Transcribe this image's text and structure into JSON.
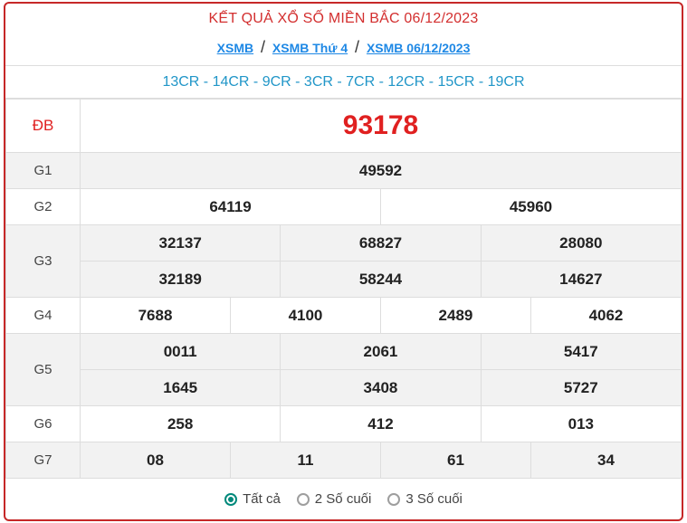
{
  "title": "KẾT QUẢ XỔ SỐ MIỀN BẮC 06/12/2023",
  "breadcrumb": {
    "sep": "/",
    "items": [
      "XSMB",
      "XSMB Thứ 4",
      "XSMB 06/12/2023"
    ]
  },
  "codes": "13CR - 14CR - 9CR - 3CR - 7CR - 12CR - 15CR - 19CR",
  "prizes": {
    "db": {
      "label": "ĐB",
      "numbers": [
        "93178"
      ]
    },
    "g1": {
      "label": "G1",
      "numbers": [
        "49592"
      ]
    },
    "g2": {
      "label": "G2",
      "numbers": [
        "64119",
        "45960"
      ]
    },
    "g3": {
      "label": "G3",
      "numbers": [
        "32137",
        "68827",
        "28080",
        "32189",
        "58244",
        "14627"
      ]
    },
    "g4": {
      "label": "G4",
      "numbers": [
        "7688",
        "4100",
        "2489",
        "4062"
      ]
    },
    "g5": {
      "label": "G5",
      "numbers": [
        "0011",
        "2061",
        "5417",
        "1645",
        "3408",
        "5727"
      ]
    },
    "g6": {
      "label": "G6",
      "numbers": [
        "258",
        "412",
        "013"
      ]
    },
    "g7": {
      "label": "G7",
      "numbers": [
        "08",
        "11",
        "61",
        "34"
      ]
    }
  },
  "filters": {
    "selected": "all",
    "options": [
      {
        "id": "all",
        "label": "Tất cả"
      },
      {
        "id": "last2",
        "label": "2 Số cuối"
      },
      {
        "id": "last3",
        "label": "3 Số cuối"
      }
    ]
  },
  "colors": {
    "accent_red": "#d32f2f",
    "link_blue": "#1e88e5",
    "codes_blue": "#2196c8",
    "radio_teal": "#00897b"
  }
}
